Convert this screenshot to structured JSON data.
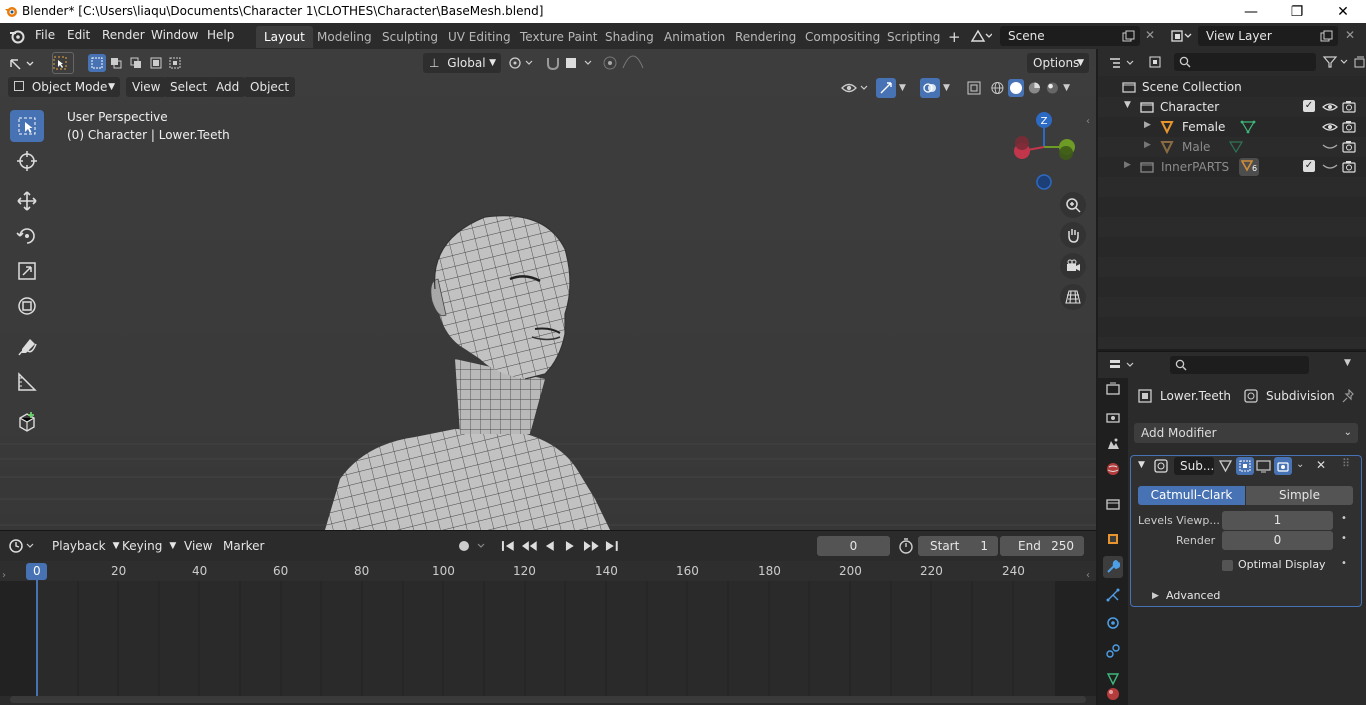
{
  "window": {
    "title": "Blender* [C:\\Users\\liaqu\\Documents\\Character 1\\CLOTHES\\Character\\BaseMesh.blend]",
    "minimize": "—",
    "maximize": "❐",
    "close": "✕"
  },
  "menu": {
    "items": [
      "File",
      "Edit",
      "Render",
      "Window",
      "Help"
    ],
    "workspaces": [
      "Layout",
      "Modeling",
      "Sculpting",
      "UV Editing",
      "Texture Paint",
      "Shading",
      "Animation",
      "Rendering",
      "Compositing",
      "Scripting"
    ],
    "active_workspace": "Layout",
    "add_tab": "+",
    "scene": "Scene",
    "view_layer": "View Layer"
  },
  "tool_header": {
    "transform_orientation": "Global",
    "options": "Options"
  },
  "viewport": {
    "mode": "Object Mode",
    "menus": [
      "View",
      "Select",
      "Add",
      "Object"
    ],
    "overlay_line1": "User Perspective",
    "overlay_line2": "(0) Character | Lower.Teeth",
    "gizmo_axis": "Z"
  },
  "timeline": {
    "menus": [
      "Playback",
      "Keying",
      "View",
      "Marker"
    ],
    "current_frame": "0",
    "start_label": "Start",
    "start": "1",
    "end_label": "End",
    "end": "250",
    "ticks": [
      "0",
      "20",
      "40",
      "60",
      "80",
      "100",
      "120",
      "140",
      "160",
      "180",
      "200",
      "220",
      "240"
    ]
  },
  "outliner": {
    "rows": [
      {
        "label": "Scene Collection"
      },
      {
        "label": "Character"
      },
      {
        "label": "Female"
      },
      {
        "label": "Male"
      },
      {
        "label": "InnerPARTS",
        "badge": "6"
      }
    ]
  },
  "properties": {
    "object_name": "Lower.Teeth",
    "modifier_name": "Subdivision",
    "add_modifier": "Add Modifier",
    "modifier_short": "Sub...",
    "catmull": "Catmull-Clark",
    "simple": "Simple",
    "levels_viewport_label": "Levels Viewp...",
    "levels_viewport": "1",
    "render_label": "Render",
    "render": "0",
    "optimal_display": "Optimal Display",
    "advanced": "Advanced"
  },
  "colors": {
    "accent": "#4772b3",
    "x_axis": "#c1364a",
    "y_axis": "#6e9b25",
    "z_axis": "#2d6ac4"
  }
}
